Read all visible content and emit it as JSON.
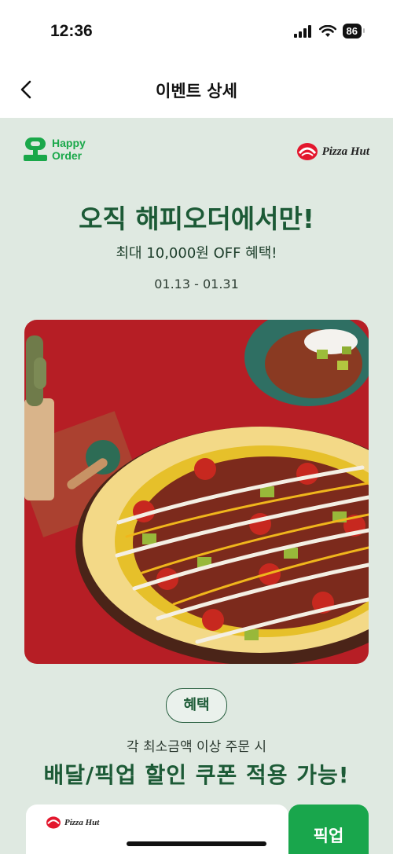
{
  "status": {
    "time": "12:36",
    "battery": "86"
  },
  "nav": {
    "title": "이벤트 상세"
  },
  "event": {
    "brand_left": {
      "line1": "Happy",
      "line2": "Order"
    },
    "brand_right": "Pizza Hut",
    "headline": "오직 해피오더에서만!",
    "subline": "최대 10,000원 OFF 혜택!",
    "dates": "01.13 - 01.31",
    "benefit_badge": "혜택",
    "condition": "각 최소금액 이상 주문 시",
    "benefit": "배달/픽업 할인 쿠폰 적용 가능!",
    "coupon": {
      "brand": "Pizza Hut",
      "side_label": "픽업"
    }
  },
  "colors": {
    "brand_green": "#19a64c",
    "dark_green": "#1c5a36",
    "background": "#dfe9e1",
    "hero_red": "#b61e25"
  },
  "icons": [
    "signal-icon",
    "wifi-icon",
    "battery-icon",
    "back-arrow-icon",
    "happy-order-logo-icon",
    "pizza-hut-logo-icon"
  ]
}
